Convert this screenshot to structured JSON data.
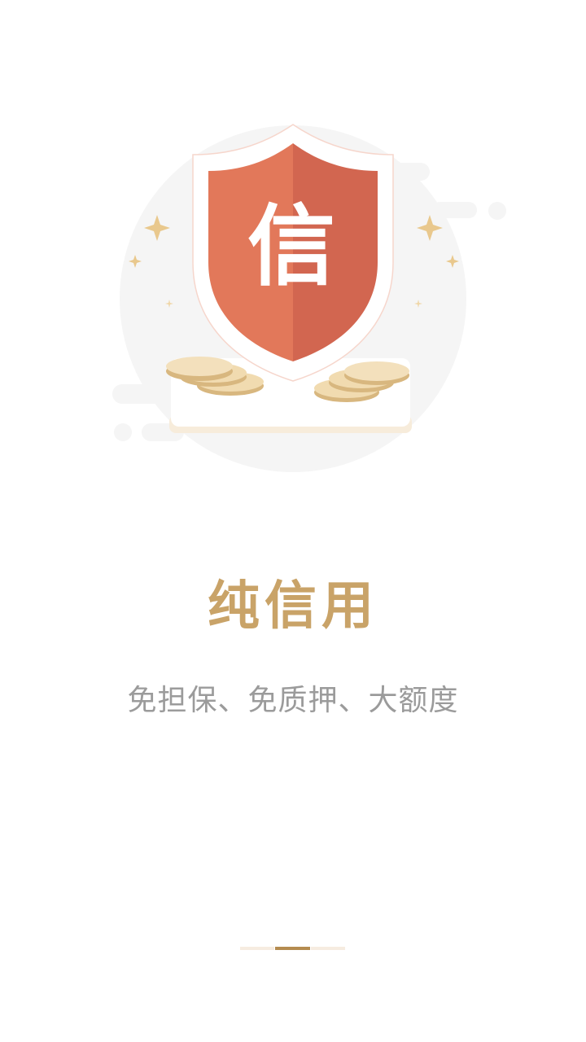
{
  "illustration": {
    "badge_char": "信",
    "shield_color_left": "#e2785a",
    "shield_color_right": "#d26650",
    "coin_color": "#f1dbb0",
    "sparkle_color": "#e9c88d"
  },
  "headline": "纯信用",
  "subheadline": "免担保、免质押、大额度",
  "pager": {
    "current": 2,
    "total": 3,
    "active_color": "#b48b4f",
    "inactive_color": "#f6ece0"
  }
}
